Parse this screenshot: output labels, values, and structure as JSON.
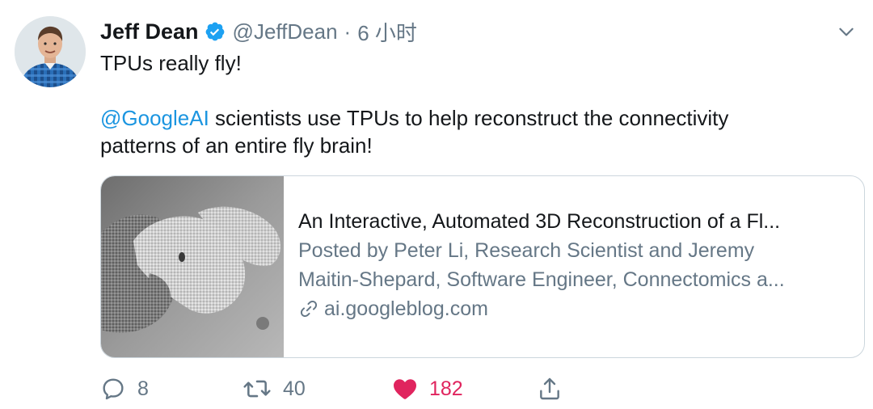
{
  "tweet": {
    "author_name": "Jeff Dean",
    "handle": "@JeffDean",
    "separator": "·",
    "time": "6 小时",
    "line1": "TPUs really fly!",
    "mention": "@GoogleAI",
    "line2_rest": " scientists use TPUs to help reconstruct the connectivity",
    "line3": "patterns of an entire fly brain!"
  },
  "card": {
    "title": "An Interactive, Automated 3D Reconstruction of a Fl...",
    "desc_line1": "Posted by Peter Li, Research Scientist and Jeremy",
    "desc_line2": "Maitin-Shepard, Software Engineer, Connectomics a...",
    "domain": "ai.googleblog.com"
  },
  "actions": {
    "reply_count": "8",
    "retweet_count": "40",
    "like_count": "182"
  },
  "colors": {
    "link_blue": "#1b95e0",
    "verified_blue": "#1da1f2",
    "like_red": "#e0245e",
    "secondary_text": "#657786",
    "border": "#ccd6dd"
  },
  "icons": [
    "verified-badge-icon",
    "chevron-down-icon",
    "link-icon",
    "reply-icon",
    "retweet-icon",
    "heart-icon",
    "share-icon"
  ]
}
